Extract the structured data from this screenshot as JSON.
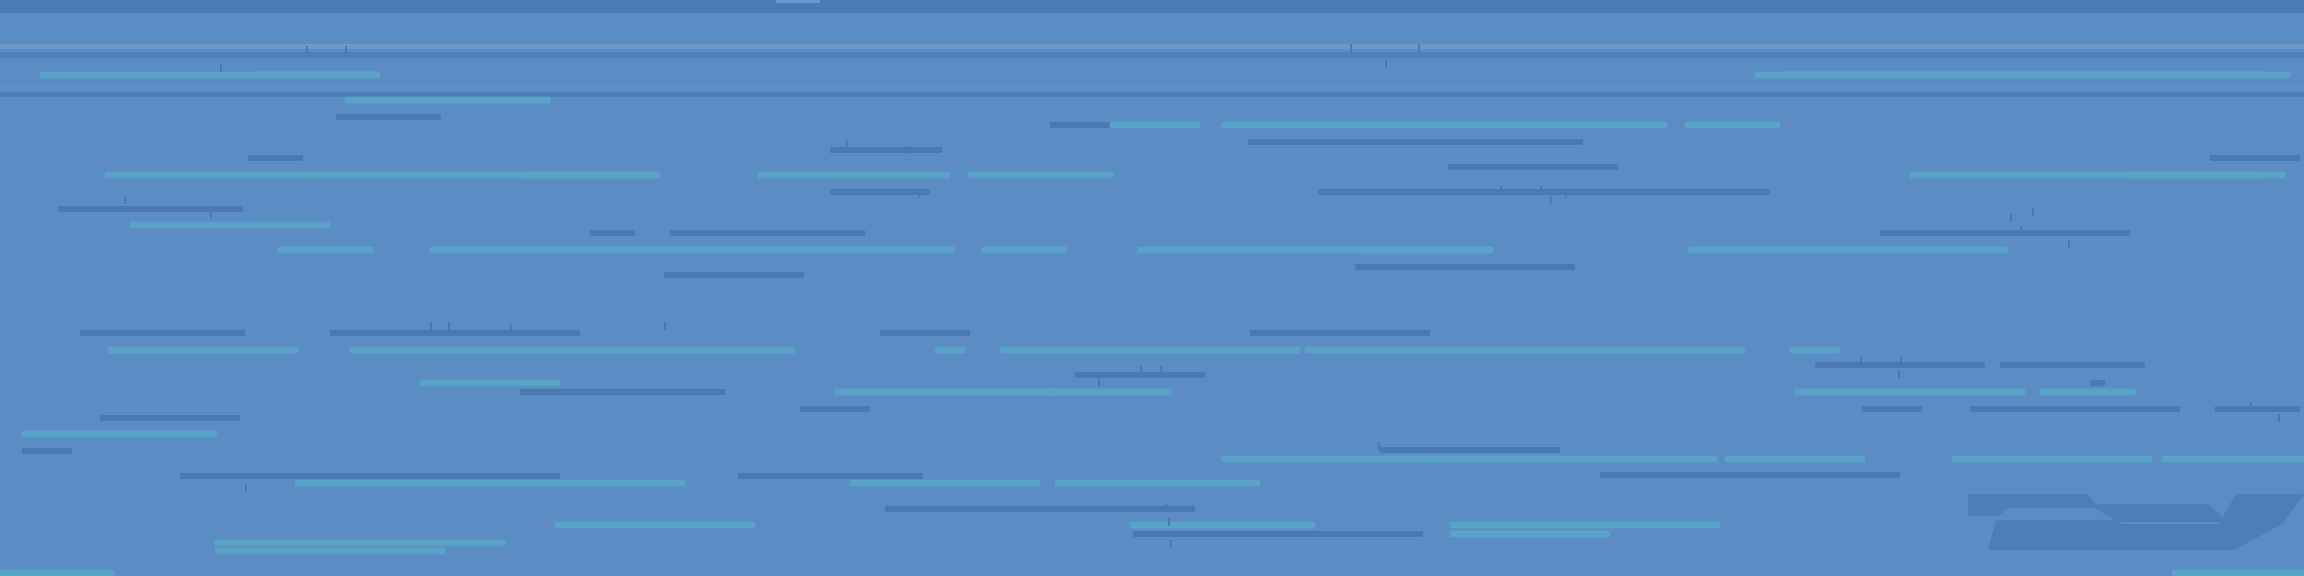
{
  "colors": {
    "background": "#5b8cc4",
    "top_band": "#4a7bb6",
    "text_line_teal": "#5aa3c8",
    "text_line_navy": "#4a78b2",
    "rule_dark": "#4f80bc",
    "rule_light": "#6f98c7"
  },
  "logo": {
    "icon": "abstract-mark-icon"
  }
}
